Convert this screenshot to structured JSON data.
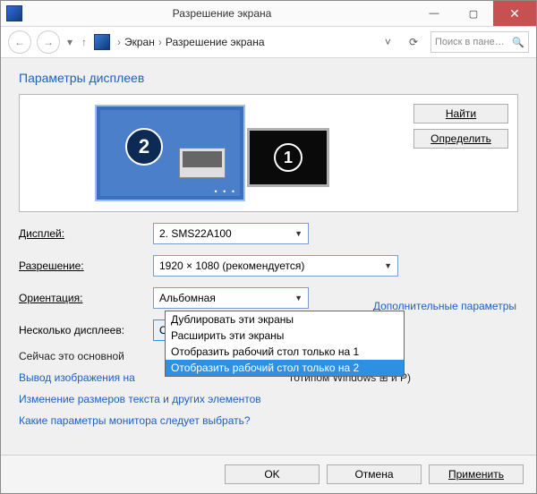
{
  "title": "Разрешение экрана",
  "breadcrumb": {
    "part1": "Экран",
    "part2": "Разрешение экрана"
  },
  "search_placeholder": "Поиск в пане…",
  "heading": "Параметры дисплеев",
  "monitor_labels": {
    "primary_badge": "2",
    "secondary_badge": "1"
  },
  "buttons": {
    "find": "Найти",
    "detect": "Определить",
    "ok": "OK",
    "cancel": "Отмена",
    "apply": "Применить"
  },
  "labels": {
    "display": "Дисплей:",
    "resolution": "Разрешение:",
    "orientation": "Ориентация:",
    "multi": "Несколько дисплеев:"
  },
  "values": {
    "display": "2. SMS22A100",
    "resolution": "1920 × 1080 (рекомендуется)",
    "orientation": "Альбомная",
    "multi": "Отобразить рабочий стол только на 2"
  },
  "multi_options": [
    "Дублировать эти экраны",
    "Расширить эти экраны",
    "Отобразить рабочий стол только на 1",
    "Отобразить рабочий стол только на 2"
  ],
  "multi_selected_index": 3,
  "status_line_prefix": "Сейчас это основной",
  "projector_line_prefix": "Вывод изображения на",
  "projector_hint_suffix": "готипом Windows",
  "projector_hint_key": "и P)",
  "advanced_link": "Дополнительные параметры",
  "textsize_link": "Изменение размеров текста и других элементов",
  "help_link": "Какие параметры монитора следует выбрать?"
}
